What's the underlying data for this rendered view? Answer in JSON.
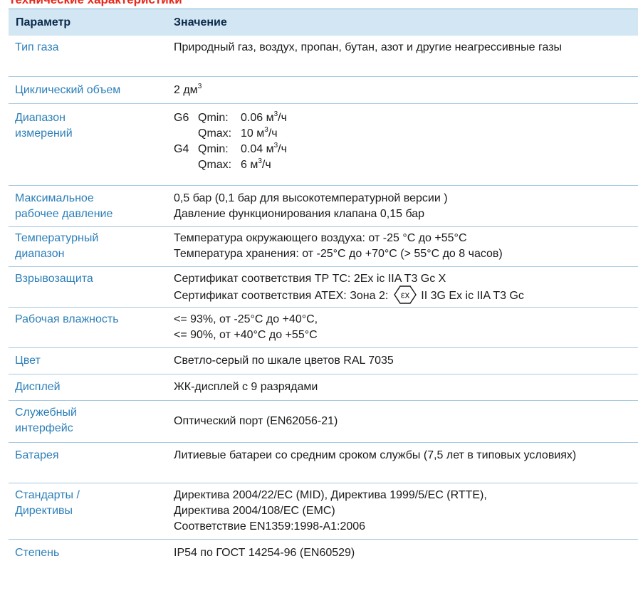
{
  "title": "Технические характеристики",
  "header": {
    "col1": "Параметр",
    "col2": "Значение"
  },
  "rows": [
    {
      "param": "Тип газа",
      "value": [
        "Природный газ, воздух, пропан, бутан, азот и другие неагрессивные газы"
      ]
    },
    {
      "param": "Циклический объем",
      "value_main": "2 дм",
      "value_sup": "3"
    },
    {
      "param": "Диапазон измерений",
      "ranges": [
        {
          "model": "G6",
          "label": "Qmin:",
          "value": "0.06 м",
          "sup": "3",
          "unit": "/ч"
        },
        {
          "model": "",
          "label": "Qmax:",
          "value": "10 м",
          "sup": "3",
          "unit": "/ч"
        },
        {
          "model": "G4",
          "label": "Qmin:",
          "value": "0.04 м",
          "sup": "3",
          "unit": "/ч"
        },
        {
          "model": "",
          "label": "Qmax:",
          "value": "6 м",
          "sup": "3",
          "unit": "/ч"
        }
      ]
    },
    {
      "param": "Максимальное рабочее давление",
      "value": [
        "0,5 бар (0,1 бар для высокотемпературной версии )",
        "Давление функционирования клапана 0,15 бар"
      ]
    },
    {
      "param": "Температурный диапазон",
      "value": [
        "Температура окружающего воздуха: от -25 °C до +55°C",
        "Температура хранения: от -25°C до +70°C (> 55°C до 8 часов)"
      ]
    },
    {
      "param": "Взрывозащита",
      "value": [
        "Сертификат соответствия ТР ТС: 2Ex ic IIA T3 Gc X",
        "Сертификат соответствия ATEX: Зона 2:",
        "II 3G Ex  ic IIA T3 Gc"
      ]
    },
    {
      "param": "Рабочая влажность",
      "value": [
        "<= 93%, от -25°C до +40°C,",
        "<= 90%, от +40°C до +55°C"
      ]
    },
    {
      "param": "Цвет",
      "value": [
        "Светло-серый по шкале цветов RAL 7035"
      ]
    },
    {
      "param": "Дисплей",
      "value": [
        "ЖК-дисплей с 9 разрядами"
      ]
    },
    {
      "param": "Служебный интерфейс",
      "value": [
        "Оптический порт (EN62056-21)"
      ]
    },
    {
      "param": "Батарея",
      "value": [
        "Литиевые батареи со средним сроком службы (7,5 лет в типовых условиях)"
      ]
    },
    {
      "param": "Стандарты / Директивы",
      "value": [
        "Директива 2004/22/EC (MID), Директива 1999/5/EC (RTTE),",
        "Директива 2004/108/EC (EMC)",
        "Соответствие EN1359:1998-A1:2006"
      ]
    },
    {
      "param": "Степень",
      "value": [
        "IP54 по ГОСТ 14254-96 (EN60529)"
      ]
    }
  ],
  "ex_icon": "ex-hexagon-icon",
  "colors": {
    "title": "#e8291c",
    "header_bg": "#d3e6f3",
    "param_text": "#2c7fb8",
    "divider": "#a7c9e2"
  }
}
